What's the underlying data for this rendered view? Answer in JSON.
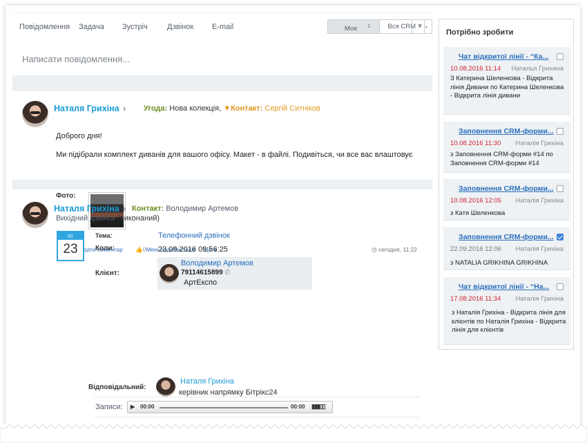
{
  "composer": {
    "tabs": [
      "Повідомлення",
      "Задача",
      "Зустріч",
      "Дзвінок",
      "E-mail"
    ],
    "filter_mine": "Мое",
    "filter_mine_count": "1",
    "filter_all": "Вся CRM",
    "placeholder": "Написати повідомлення..."
  },
  "post1": {
    "author": "Наталя Грихіна",
    "deal_label": "Угода:",
    "deal_value": "Нова колекція,",
    "contact_label": "Контакт:",
    "contact_value": "Сергій Ситніков",
    "greeting": "Доброго дня!",
    "body": "Ми підібрали комплект диванів для вашого офісу. Макет - в файлі. Подивіться, чи все вас влаштовує",
    "photo_label": "Фото:",
    "add_comment": "Додати коментар",
    "like": "Мені подобається",
    "like_count": "0",
    "more": "Ще",
    "time": "сегодня, 11:22"
  },
  "post2": {
    "author": "Наталя Грихіна",
    "contact_label": "Контакт:",
    "contact_value": "Володимир Артемов",
    "subtitle": "Вихідний дзвінок",
    "status": "(виконаний)",
    "cal_day": "пт",
    "cal_num": "23",
    "topic_label": "Тема:",
    "topic_value": "Телефонний дзвінок",
    "when_label": "Коли:",
    "when_value": "23.09.2016 09:56:25",
    "client_label": "Клієнт:",
    "client_name": "Володимир Артемов",
    "client_phone": "79114615899",
    "client_company": "АртЕкспо",
    "resp_label": "Відповідальний:",
    "resp_name": "Наталя Грихіна",
    "resp_role": "керівник напрямку Бітрікс24",
    "records_label": "Записи:",
    "audio_start": "00:00",
    "audio_end": "00:00"
  },
  "todo": {
    "title": "Потрібно зробити",
    "items": [
      {
        "title": "Чат відкритої лінії - “Ка...",
        "date": "10.08.2016 11:14",
        "who": "Наталья Грихина",
        "desc": "З Катерина Шеленкова - Відкрита лінія Дивани по Катерина Шеленкова - Відкрита лінія дивани",
        "done": false
      },
      {
        "title": "Заповнення CRM-форми...",
        "date": "10.08.2016 11:30",
        "who": "Наталія Грихіна",
        "desc": "з Заповнення CRM-форми #14 по Заповнення CRM-форми #14",
        "done": false
      },
      {
        "title": "Заповнення CRM-форми...",
        "date": "10.08.2016 12:05",
        "who": "Наталія Грихіна",
        "desc": "з Катя Шеленкова",
        "done": false
      },
      {
        "title": "Заповнення CRM-форми...",
        "date": "22.09.2016 12:06",
        "who": "Наталія Грихіна",
        "desc": "з NATALIA GRIKHINA GRIKHINA",
        "done": true
      },
      {
        "title": "Чат відкритої лінії - “На...",
        "date": "17.08.2016 11:34",
        "who": "Наталія Грихіна",
        "desc": "з Наталія Грихіна - Відкрита лінія для клієнтів по Наталія Грихіна - Відкрита лінія для клієнтів",
        "done": false
      }
    ]
  }
}
